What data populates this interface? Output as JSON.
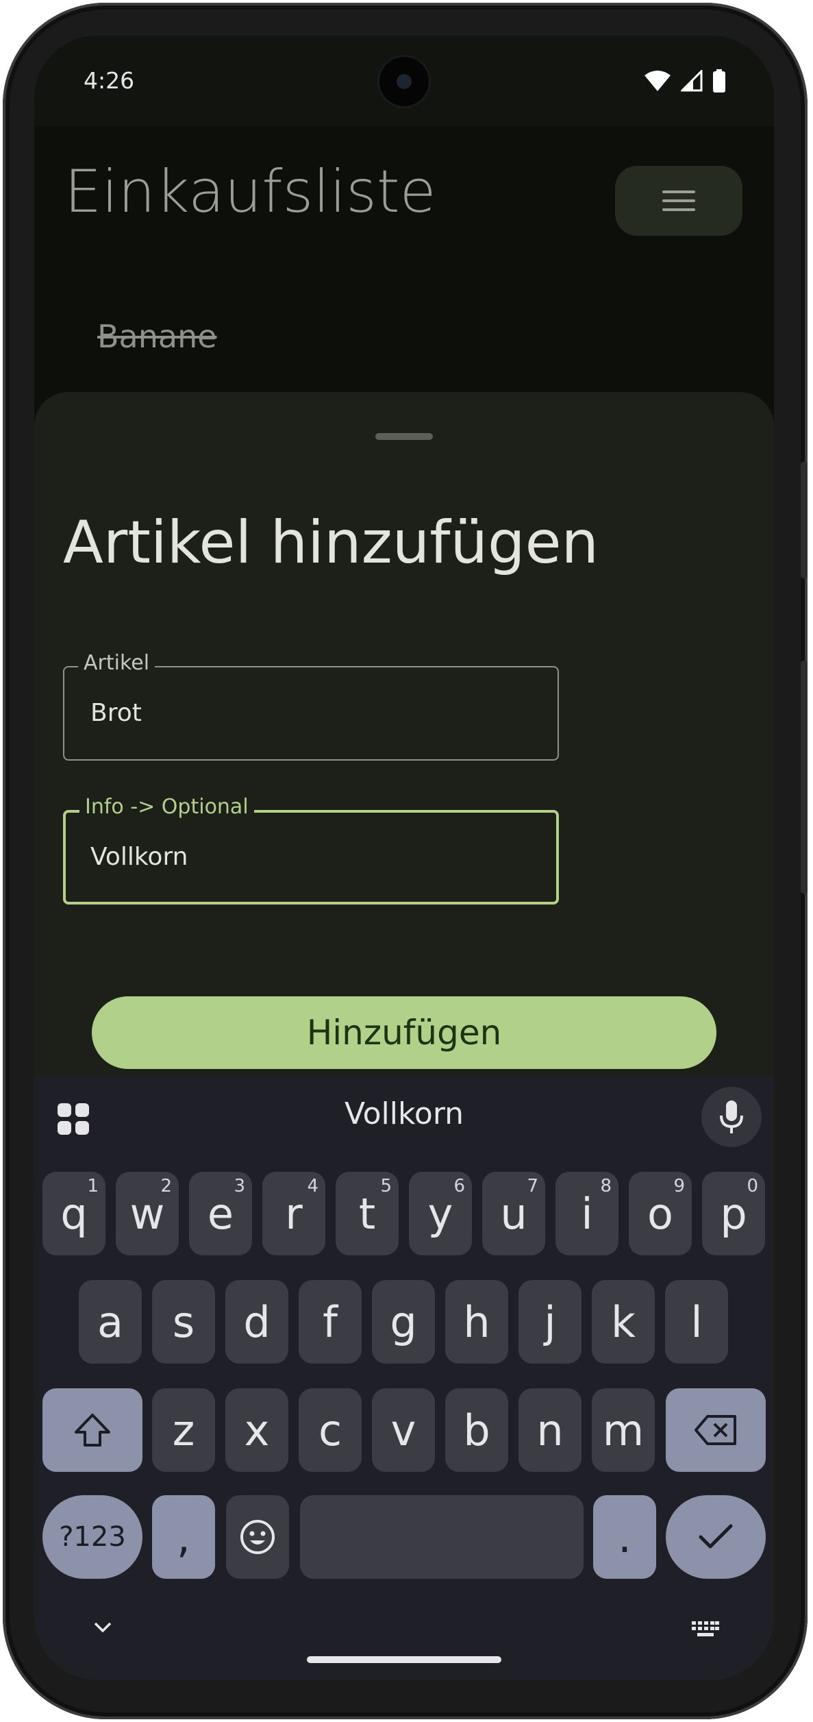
{
  "status_bar": {
    "time": "4:26"
  },
  "app": {
    "title": "Einkaufsliste",
    "menu_icon": "menu-icon",
    "items": [
      {
        "label": "Banane",
        "checked": true
      }
    ]
  },
  "sheet": {
    "title": "Artikel hinzufügen",
    "fields": [
      {
        "label": "Artikel",
        "value": "Brot",
        "focused": false
      },
      {
        "label": "Info -> Optional",
        "value": "Vollkorn",
        "focused": true
      }
    ],
    "add_button": "Hinzufügen"
  },
  "keyboard": {
    "suggestion": "Vollkorn",
    "row1": [
      {
        "k": "q",
        "h": "1"
      },
      {
        "k": "w",
        "h": "2"
      },
      {
        "k": "e",
        "h": "3"
      },
      {
        "k": "r",
        "h": "4"
      },
      {
        "k": "t",
        "h": "5"
      },
      {
        "k": "y",
        "h": "6"
      },
      {
        "k": "u",
        "h": "7"
      },
      {
        "k": "i",
        "h": "8"
      },
      {
        "k": "o",
        "h": "9"
      },
      {
        "k": "p",
        "h": "0"
      }
    ],
    "row2": [
      "a",
      "s",
      "d",
      "f",
      "g",
      "h",
      "j",
      "k",
      "l"
    ],
    "row3": [
      "z",
      "x",
      "c",
      "v",
      "b",
      "n",
      "m"
    ],
    "symbols_label": "?123",
    "comma": ",",
    "period": "."
  },
  "colors": {
    "accent": "#b1d18a",
    "sheet_bg": "#1d1f19",
    "keyboard_bg": "#1f2027",
    "function_key": "#8c92aa"
  }
}
